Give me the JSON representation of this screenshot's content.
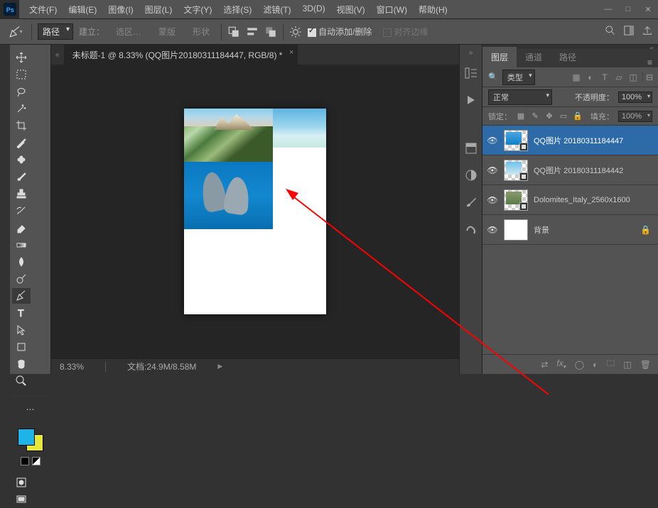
{
  "menu": {
    "items": [
      "文件(F)",
      "编辑(E)",
      "图像(I)",
      "图层(L)",
      "文字(Y)",
      "选择(S)",
      "滤镜(T)",
      "3D(D)",
      "视图(V)",
      "窗口(W)",
      "帮助(H)"
    ]
  },
  "optbar": {
    "path_label": "路径",
    "build": "建立：",
    "selection": "选区…",
    "mask": "蒙版",
    "shape": "形状",
    "auto_add_delete": "自动添加/删除",
    "align_edges": "对齐边缘"
  },
  "document": {
    "tab_title": "未标题-1 @ 8.33% (QQ图片20180311184447, RGB/8) *",
    "zoom": "8.33%",
    "file_info": "文档:24.9M/8.58M"
  },
  "panel": {
    "tabs": [
      "图层",
      "通道",
      "路径"
    ],
    "filter_kind": "类型",
    "blend_mode": "正常",
    "opacity_label": "不透明度：",
    "opacity_value": "100%",
    "lock_label": "锁定：",
    "fill_label": "填充：",
    "fill_value": "100%",
    "layers": [
      {
        "name": "QQ图片 20180311184447",
        "smart": true,
        "thumb": "checker-ocean",
        "active": true
      },
      {
        "name": "QQ图片 20180311184442",
        "smart": true,
        "thumb": "checker-sky"
      },
      {
        "name": "Dolomites_Italy_2560x1600",
        "smart": true,
        "thumb": "checker-mtn"
      },
      {
        "name": "背景",
        "locked": true,
        "thumb": "white"
      }
    ]
  },
  "chart_data": null
}
